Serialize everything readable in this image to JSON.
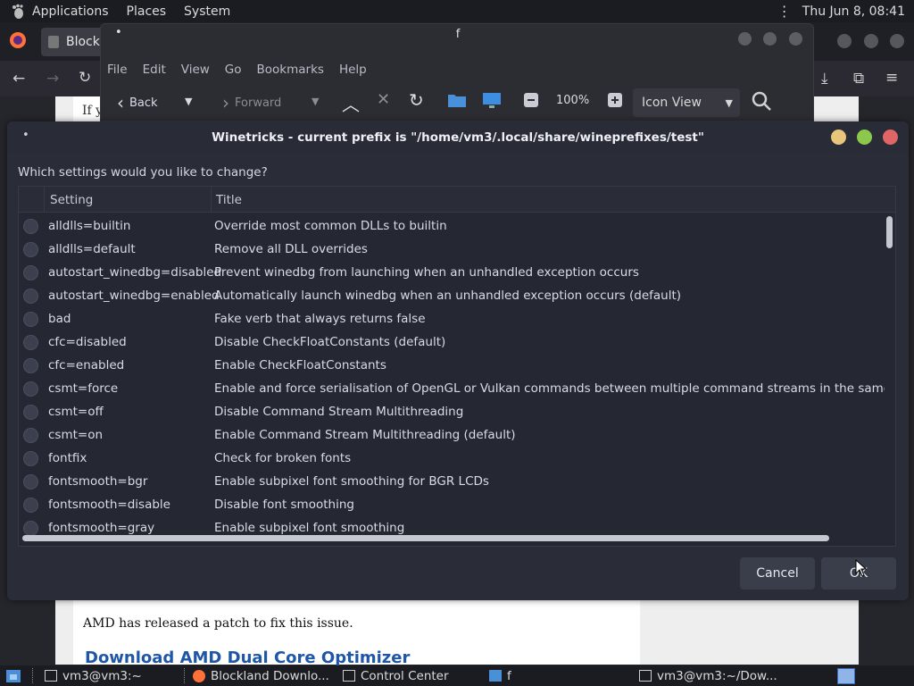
{
  "top_panel": {
    "menus": [
      "Applications",
      "Places",
      "System"
    ],
    "clock": "Thu Jun  8, 08:41"
  },
  "firefox": {
    "tab_title": "Blockl",
    "page_fragment": "If y",
    "page_text": "AMD has released a patch to fix this issue.",
    "page_heading": "Download AMD Dual Core Optimizer"
  },
  "file_manager": {
    "title": "f",
    "menu": [
      "File",
      "Edit",
      "View",
      "Go",
      "Bookmarks",
      "Help"
    ],
    "back_label": "Back",
    "forward_label": "Forward",
    "zoom": "100%",
    "view_mode": "Icon View"
  },
  "winetricks": {
    "title": "Winetricks - current prefix is \"/home/vm3/.local/share/wineprefixes/test\"",
    "question": "Which settings would you like to change?",
    "columns": [
      "Setting",
      "Title"
    ],
    "rows": [
      {
        "setting": "alldlls=builtin",
        "title": "Override most common DLLs to builtin"
      },
      {
        "setting": "alldlls=default",
        "title": "Remove all DLL overrides"
      },
      {
        "setting": "autostart_winedbg=disabled",
        "title": "Prevent winedbg from launching when an unhandled exception occurs"
      },
      {
        "setting": "autostart_winedbg=enabled",
        "title": "Automatically launch winedbg when an unhandled exception occurs (default)"
      },
      {
        "setting": "bad",
        "title": "Fake verb that always returns false"
      },
      {
        "setting": "cfc=disabled",
        "title": "Disable CheckFloatConstants (default)"
      },
      {
        "setting": "cfc=enabled",
        "title": "Enable CheckFloatConstants"
      },
      {
        "setting": "csmt=force",
        "title": "Enable and force serialisation of OpenGL or Vulkan commands between multiple command streams in the same application"
      },
      {
        "setting": "csmt=off",
        "title": "Disable Command Stream Multithreading"
      },
      {
        "setting": "csmt=on",
        "title": "Enable Command Stream Multithreading (default)"
      },
      {
        "setting": "fontfix",
        "title": "Check for broken fonts"
      },
      {
        "setting": "fontsmooth=bgr",
        "title": "Enable subpixel font smoothing for BGR LCDs"
      },
      {
        "setting": "fontsmooth=disable",
        "title": "Disable font smoothing"
      },
      {
        "setting": "fontsmooth=gray",
        "title": "Enable subpixel font smoothing"
      }
    ],
    "cancel_label": "Cancel",
    "ok_label": "OK"
  },
  "taskbar": {
    "items": [
      "vm3@vm3:~",
      "Blockland Downlo...",
      "Control Center",
      "f",
      "vm3@vm3:~/Dow..."
    ]
  },
  "colors": {
    "dialog_bg": "#2a2d38",
    "list_bg": "#252833",
    "link_blue": "#1f57a6",
    "close_red": "#e06666",
    "max_green": "#8cc84b",
    "min_yellow": "#e8c57a"
  }
}
